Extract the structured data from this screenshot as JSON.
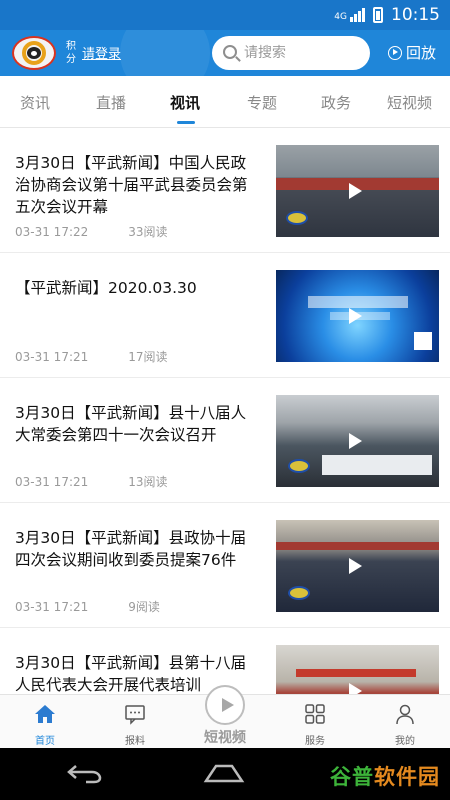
{
  "status_bar": {
    "network": "4G",
    "time": "10:15"
  },
  "header": {
    "score_label": "积分",
    "login_label": "请登录",
    "search_placeholder": "请搜索",
    "replay_label": "回放"
  },
  "tabs": [
    {
      "label": "资讯"
    },
    {
      "label": "直播"
    },
    {
      "label": "视讯",
      "active": true
    },
    {
      "label": "专题"
    },
    {
      "label": "政务"
    },
    {
      "label": "短视频"
    }
  ],
  "news": [
    {
      "title": "3月30日【平武新闻】中国人民政治协商会议第十届平武县委员会第五次会议开幕",
      "time": "03-31 17:22",
      "reads": "33阅读"
    },
    {
      "title": "【平武新闻】2020.03.30",
      "time": "03-31 17:21",
      "reads": "17阅读"
    },
    {
      "title": "3月30日【平武新闻】县十八届人大常委会第四十一次会议召开",
      "time": "03-31 17:21",
      "reads": "13阅读"
    },
    {
      "title": "3月30日【平武新闻】县政协十届四次会议期间收到委员提案76件",
      "time": "03-31 17:21",
      "reads": "9阅读"
    },
    {
      "title": "3月30日【平武新闻】县第十八届人民代表大会开展代表培训",
      "time": "",
      "reads": ""
    }
  ],
  "bottom_nav": {
    "home": "首页",
    "report": "报料",
    "short_video": "短视频",
    "service": "服务",
    "mine": "我的"
  },
  "brand": {
    "part1": "谷普",
    "part2": "软件园"
  },
  "colors": {
    "accent": "#1f86d9",
    "header": "#1f86d9",
    "status_bar": "#1976c9"
  }
}
